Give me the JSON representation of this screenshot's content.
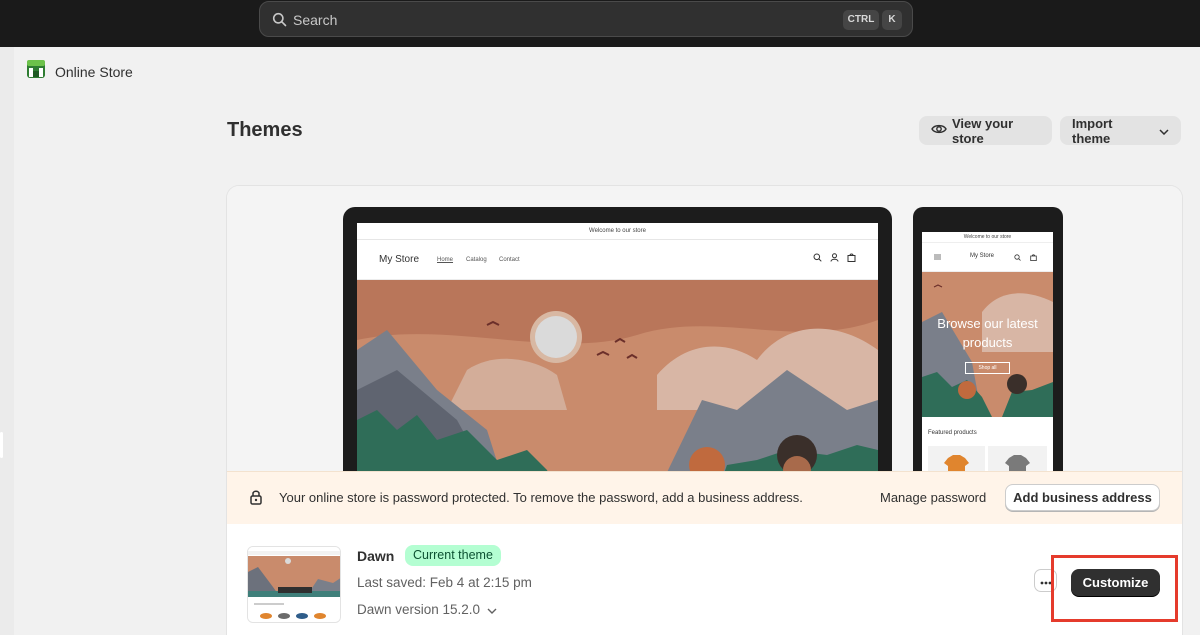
{
  "topbar": {
    "search_placeholder": "Search",
    "shortcut_ctrl": "CTRL",
    "shortcut_key": "K"
  },
  "app": {
    "name": "Online Store",
    "icon": "storefront-icon",
    "accent": "#008060"
  },
  "page": {
    "title": "Themes"
  },
  "header_actions": {
    "view_store": "View your store",
    "import_theme": "Import theme"
  },
  "preview": {
    "announcement": "Welcome to our store",
    "store_name": "My Store",
    "nav": [
      "Home",
      "Catalog",
      "Contact"
    ],
    "mobile_headline": "Browse our latest products",
    "mobile_button": "Shop all",
    "mobile_featured": "Featured products"
  },
  "banner": {
    "message": "Your online store is password protected. To remove the password, add a business address.",
    "manage_password": "Manage password",
    "add_business_address": "Add business address"
  },
  "theme": {
    "name": "Dawn",
    "badge": "Current theme",
    "last_saved": "Last saved: Feb 4 at 2:15 pm",
    "version": "Dawn version 15.2.0",
    "customize": "Customize"
  },
  "colors": {
    "badge_bg": "#b4fed2",
    "banner_bg": "#fff4e9",
    "primary_button": "#303030",
    "highlight": "#e53b2c"
  }
}
